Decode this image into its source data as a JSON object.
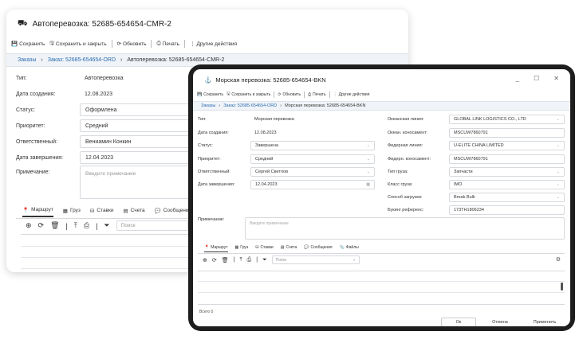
{
  "back_window": {
    "title": "Автоперевозка: 52685-654654-CMR-2",
    "toolbar": {
      "save": "Сохранить",
      "save_close": "Сохранить и закрыть",
      "refresh": "Обновить",
      "print": "Печать",
      "other": "Другие действия"
    },
    "breadcrumb": {
      "root": "Заказы",
      "order": "Заказ: 52685-654654-ORD",
      "current": "Автоперевозка: 52685-654654-CMR-2"
    },
    "fields": {
      "type_label": "Тип:",
      "type_value": "Автоперевозка",
      "created_label": "Дата создания:",
      "created_value": "12.08.2023",
      "status_label": "Статус:",
      "status_value": "Оформлена",
      "priority_label": "Приоритет:",
      "priority_value": "Средний",
      "responsible_label": "Ответственный:",
      "responsible_value": "Вениамин Конкин",
      "completion_label": "Дата завершения:",
      "completion_value": "12.04.2023",
      "note_label": "Примечание:",
      "note_placeholder": "Введите примечание"
    },
    "tabs": [
      "Маршрут",
      "Груз",
      "Ставки",
      "Счета",
      "Сообщения"
    ],
    "search_placeholder": "Поиск"
  },
  "front_window": {
    "title": "Морская перевозка: 52685-654654-BKN",
    "window_controls": {
      "minimize": "_",
      "maximize": "☐",
      "close": "✕"
    },
    "toolbar": {
      "save": "Сохранить",
      "save_close": "Сохранить и закрыть",
      "refresh": "Обновить",
      "print": "Печать",
      "other": "Другие действия"
    },
    "breadcrumb": {
      "root": "Заказы",
      "order": "Заказ: 52685-654654-ORD",
      "current": "Морская перевозка: 52685-654654-BKN"
    },
    "left_fields": {
      "type_label": "Тип:",
      "type_value": "Морская перевозка",
      "created_label": "Дата создания:",
      "created_value": "12.08.2023",
      "status_label": "Статус:",
      "status_value": "Завершена",
      "priority_label": "Приоритет:",
      "priority_value": "Средний",
      "responsible_label": "Ответственный:",
      "responsible_value": "Сергей Светлов",
      "completion_label": "Дата завершения:",
      "completion_value": "12.04.2023"
    },
    "right_fields": {
      "ocean_line_label": "Океанская линия:",
      "ocean_line_value": "GLOBAL LINK LOGISTICS CO., LTD",
      "ocean_bl_label": "Океан. коносамент:",
      "ocean_bl_value": "MSCUW7860791",
      "feeder_line_label": "Фидерная линия:",
      "feeder_line_value": "U-ELITE CHINA LIMITED",
      "feeder_bl_label": "Фидерн. коносамент:",
      "feeder_bl_value": "MSCUW7860791",
      "cargo_type_label": "Тип груза:",
      "cargo_type_value": "Запчасти",
      "cargo_class_label": "Класс груза:",
      "cargo_class_value": "IMO",
      "loading_label": "Способ загрузки:",
      "loading_value": "Break Bulk",
      "booking_label": "Букинг референс:",
      "booking_value": "173TH1806234"
    },
    "note_label": "Примечание:",
    "note_placeholder": "Введите примечание",
    "tabs": [
      "Маршрут",
      "Груз",
      "Ставки",
      "Счета",
      "Сообщения",
      "Файлы"
    ],
    "search_placeholder": "Поиск",
    "total": "Всего 0",
    "buttons": {
      "ok": "Ок",
      "cancel": "Отмена",
      "apply": "Применить"
    }
  }
}
